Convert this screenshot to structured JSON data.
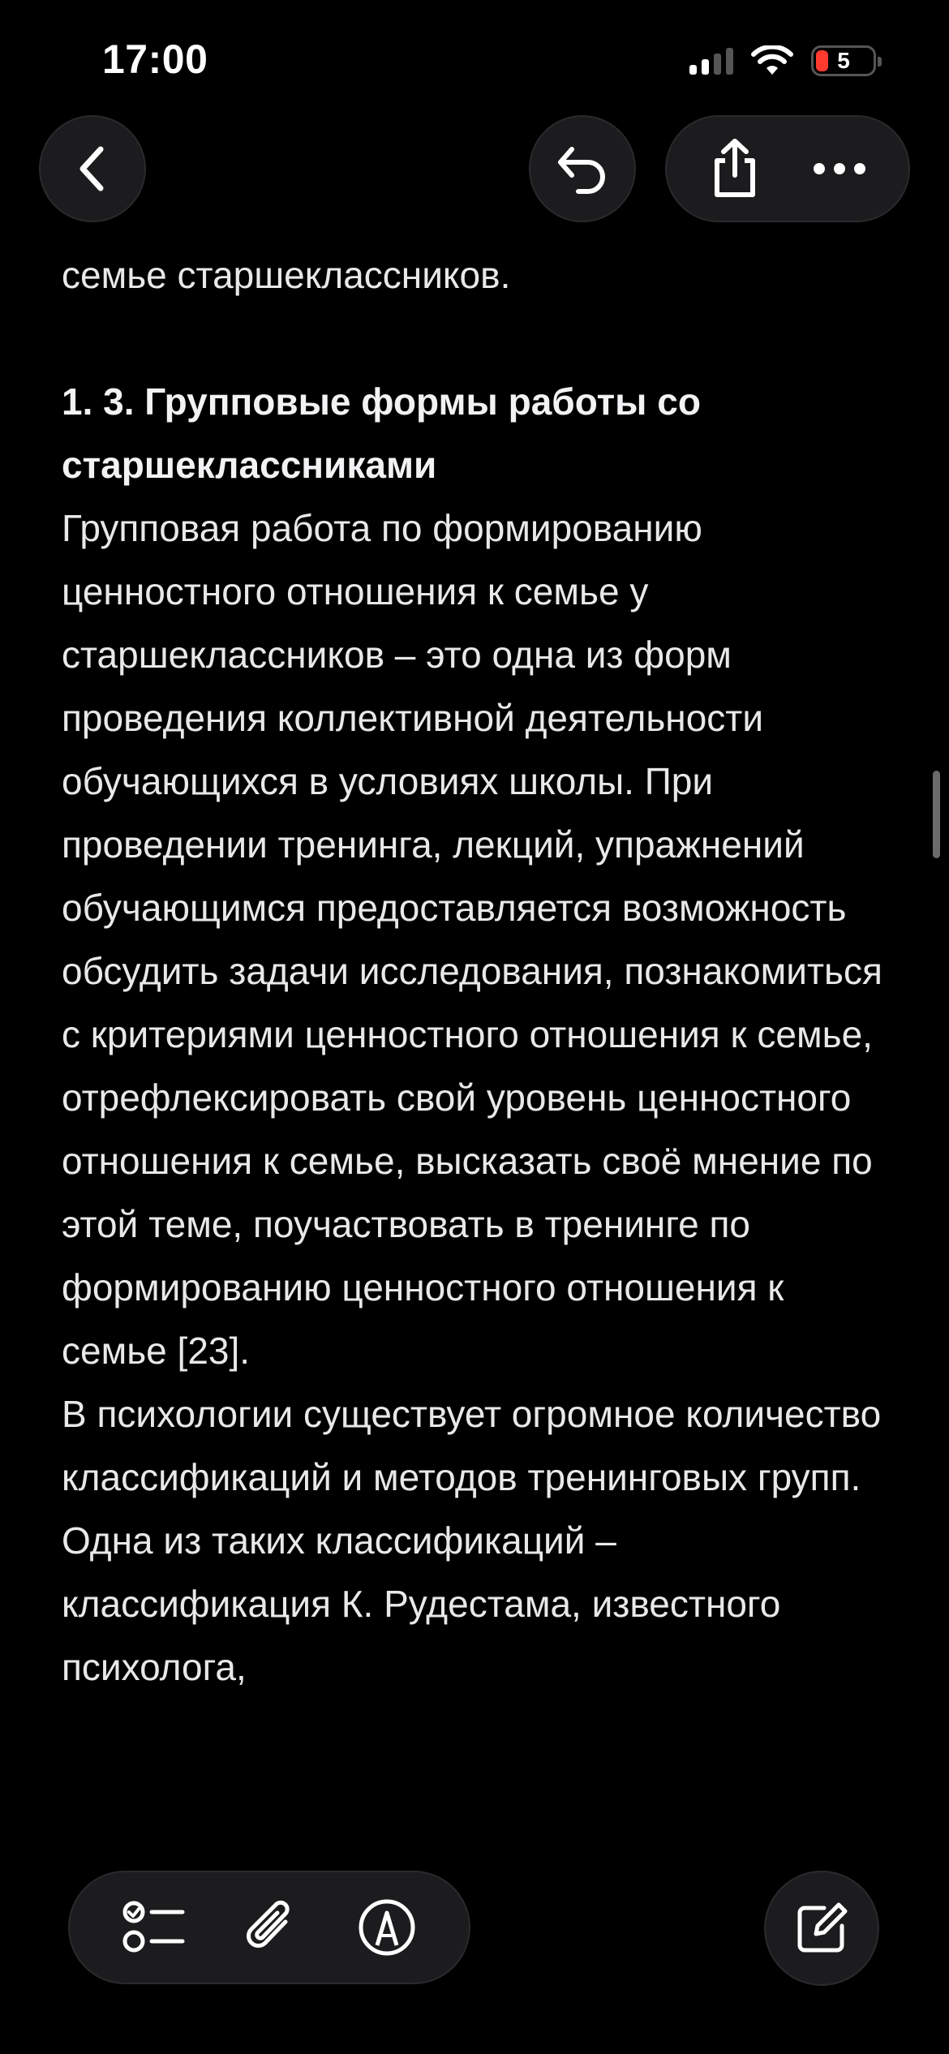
{
  "status_bar": {
    "time": "17:00",
    "battery_level": "5",
    "icons": [
      "signal-icon",
      "wifi-icon",
      "battery-icon"
    ],
    "colors": {
      "battery_low": "#ff3b30"
    }
  },
  "toolbar_top": {
    "icons": [
      "back-chevron-icon",
      "undo-icon",
      "share-icon",
      "more-icon"
    ]
  },
  "note": {
    "lines_top": "семье старшеклассников.",
    "heading": "1. 3. Групповые формы работы со старшеклассниками",
    "paragraph1": "Групповая работа по формированию ценностного отношения к семье у старшеклассников – это одна из форм проведения коллективной деятельности обучающихся в условиях школы. При проведении тренинга, лекций, упражнений обучающимся предоставляется возможность обсудить задачи исследования, познакомиться с критериями ценностного отношения к семье, отрефлексировать свой уровень ценностного отношения к семье, высказать своё мнение по этой теме, поучаствовать в тренинге по формированию ценностного отношения к семье [23].",
    "paragraph2": "В психологии существует огромное количество классификаций и методов тренинговых групп. Одна из таких классификаций – классификация К. Рудестама, известного психолога,"
  },
  "toolbar_bottom": {
    "icons": [
      "checklist-icon",
      "paperclip-icon",
      "markup-pen-icon",
      "compose-icon"
    ]
  },
  "colors": {
    "background": "#000000",
    "button_bg": "#1c1c1e",
    "text": "#e8e8ea"
  }
}
